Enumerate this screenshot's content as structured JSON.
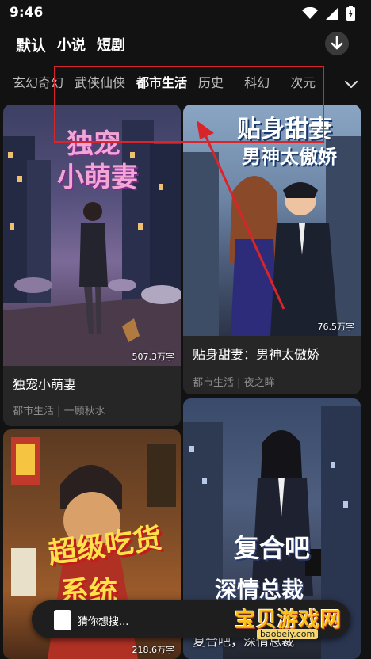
{
  "status_bar": {
    "time": "9:46"
  },
  "top_tabs": [
    {
      "label": "默认",
      "active": true
    },
    {
      "label": "小说",
      "active": false
    },
    {
      "label": "短剧",
      "active": false
    }
  ],
  "categories": [
    {
      "label": "玄幻奇幻",
      "active": false
    },
    {
      "label": "武侠仙侠",
      "active": false
    },
    {
      "label": "都市生活",
      "active": true
    },
    {
      "label": "历史",
      "active": false
    },
    {
      "label": "科幻",
      "active": false
    },
    {
      "label": "次元",
      "active": false
    }
  ],
  "books": [
    {
      "title": "独宠小萌妻",
      "meta": "都市生活 | 一顾秋水",
      "word_count": "507.3万字",
      "cover_text": [
        "独宠",
        "小萌妻"
      ]
    },
    {
      "title": "贴身甜妻：男神太傲娇",
      "meta": "都市生活 | 夜之眸",
      "word_count": "76.5万字",
      "cover_text": [
        "贴身甜妻",
        "男神太傲娇"
      ]
    },
    {
      "title": "",
      "meta": "",
      "word_count": "218.6万字",
      "cover_text": [
        "超级吃货",
        "系统"
      ]
    },
    {
      "title": "复合吧，深情总裁",
      "meta": "",
      "word_count": "",
      "cover_text": [
        "复合吧",
        "深情总裁"
      ]
    }
  ],
  "search": {
    "text": "猜你想搜..."
  },
  "watermark": {
    "name": "宝贝游戏网",
    "url": "baobeiy.com"
  },
  "colors": {
    "background": "#121212",
    "card": "#262626",
    "annotation": "#d8242b",
    "accent": "#f7c21a"
  }
}
